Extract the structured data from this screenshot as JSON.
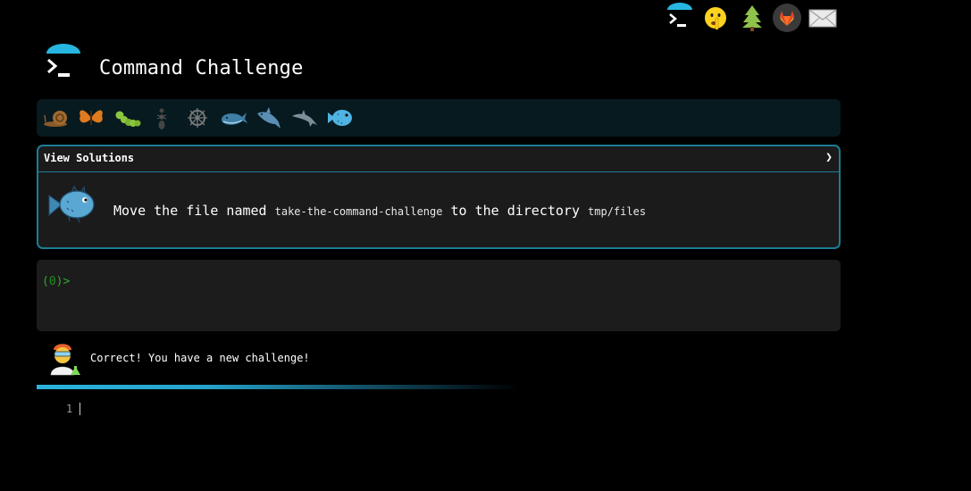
{
  "header": {
    "title": "Command Challenge"
  },
  "top_icons": [
    "terminal-icon",
    "shushing-face-icon",
    "evergreen-tree-icon",
    "gitlab-icon",
    "envelope-icon"
  ],
  "levels": [
    "snail-icon",
    "butterfly-icon",
    "caterpillar-icon",
    "ant-icon",
    "ship-wheel-icon",
    "whale-icon",
    "shark-icon",
    "dolphin-icon",
    "blowfish-icon"
  ],
  "panel": {
    "view_solutions": "View Solutions",
    "chevron": "❯",
    "task_prefix": "Move the file named",
    "task_file": "take-the-command-challenge",
    "task_middle": "to the directory",
    "task_dir": "tmp/files"
  },
  "terminal": {
    "prompt_open": "(",
    "prompt_count": "0",
    "prompt_close": ")>"
  },
  "feedback": {
    "message": "Correct! You have a new challenge!"
  },
  "editor": {
    "line_number": "1"
  },
  "colors": {
    "accent": "#1b7d95",
    "progress": "#2ab3dd",
    "prompt": "#2ea82e",
    "panel_bg": "#1b1b1b",
    "levels_bg": "#071a1f"
  }
}
